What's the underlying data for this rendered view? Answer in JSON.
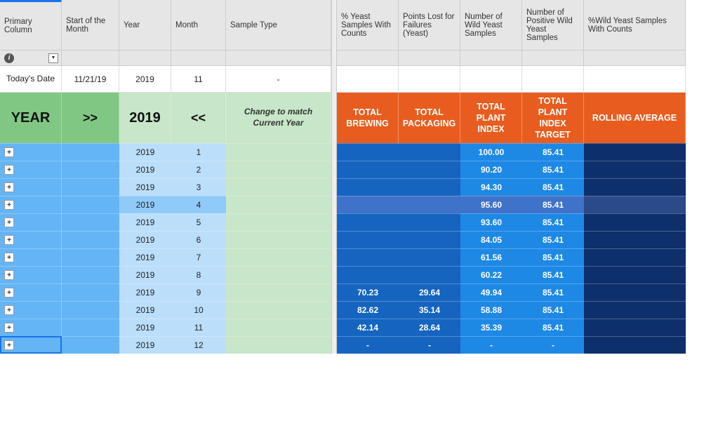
{
  "headers": {
    "left": [
      "Primary Column",
      "Start of the Month",
      "Year",
      "Month",
      "Sample Type"
    ],
    "right": [
      "% Yeast Samples With Counts",
      "Points Lost for Failures (Yeast)",
      "Number of Wild Yeast Samples",
      "Number of Positive Wild Yeast Samples",
      "%Wild Yeast Samples With Counts"
    ]
  },
  "today_row": {
    "label": "Today's Date",
    "date": "11/21/19",
    "year": "2019",
    "month": "11",
    "sample": "-"
  },
  "band": {
    "year_label": "YEAR",
    "next": ">>",
    "year_value": "2019",
    "prev": "<<",
    "note": "Change to match Current Year",
    "totals": [
      "TOTAL BREWING",
      "TOTAL PACKAGING",
      "TOTAL PLANT INDEX",
      "TOTAL PLANT INDEX TARGET",
      "ROLLING AVERAGE"
    ]
  },
  "rows": [
    {
      "year": "2019",
      "month": "1",
      "brew": "",
      "pack": "",
      "plant": "100.00",
      "target": "85.41",
      "roll": "",
      "hl": false
    },
    {
      "year": "2019",
      "month": "2",
      "brew": "",
      "pack": "",
      "plant": "90.20",
      "target": "85.41",
      "roll": "",
      "hl": false
    },
    {
      "year": "2019",
      "month": "3",
      "brew": "",
      "pack": "",
      "plant": "94.30",
      "target": "85.41",
      "roll": "",
      "hl": false
    },
    {
      "year": "2019",
      "month": "4",
      "brew": "",
      "pack": "",
      "plant": "95.60",
      "target": "85.41",
      "roll": "",
      "hl": true
    },
    {
      "year": "2019",
      "month": "5",
      "brew": "",
      "pack": "",
      "plant": "93.60",
      "target": "85.41",
      "roll": "",
      "hl": false
    },
    {
      "year": "2019",
      "month": "6",
      "brew": "",
      "pack": "",
      "plant": "84.05",
      "target": "85.41",
      "roll": "",
      "hl": false
    },
    {
      "year": "2019",
      "month": "7",
      "brew": "",
      "pack": "",
      "plant": "61.56",
      "target": "85.41",
      "roll": "",
      "hl": false
    },
    {
      "year": "2019",
      "month": "8",
      "brew": "",
      "pack": "",
      "plant": "60.22",
      "target": "85.41",
      "roll": "",
      "hl": false
    },
    {
      "year": "2019",
      "month": "9",
      "brew": "70.23",
      "pack": "29.64",
      "plant": "49.94",
      "target": "85.41",
      "roll": "",
      "hl": false
    },
    {
      "year": "2019",
      "month": "10",
      "brew": "82.62",
      "pack": "35.14",
      "plant": "58.88",
      "target": "85.41",
      "roll": "",
      "hl": false
    },
    {
      "year": "2019",
      "month": "11",
      "brew": "42.14",
      "pack": "28.64",
      "plant": "35.39",
      "target": "85.41",
      "roll": "",
      "hl": false
    },
    {
      "year": "2019",
      "month": "12",
      "brew": "-",
      "pack": "-",
      "plant": "-",
      "target": "-",
      "roll": "",
      "hl": false,
      "sel": true
    }
  ]
}
